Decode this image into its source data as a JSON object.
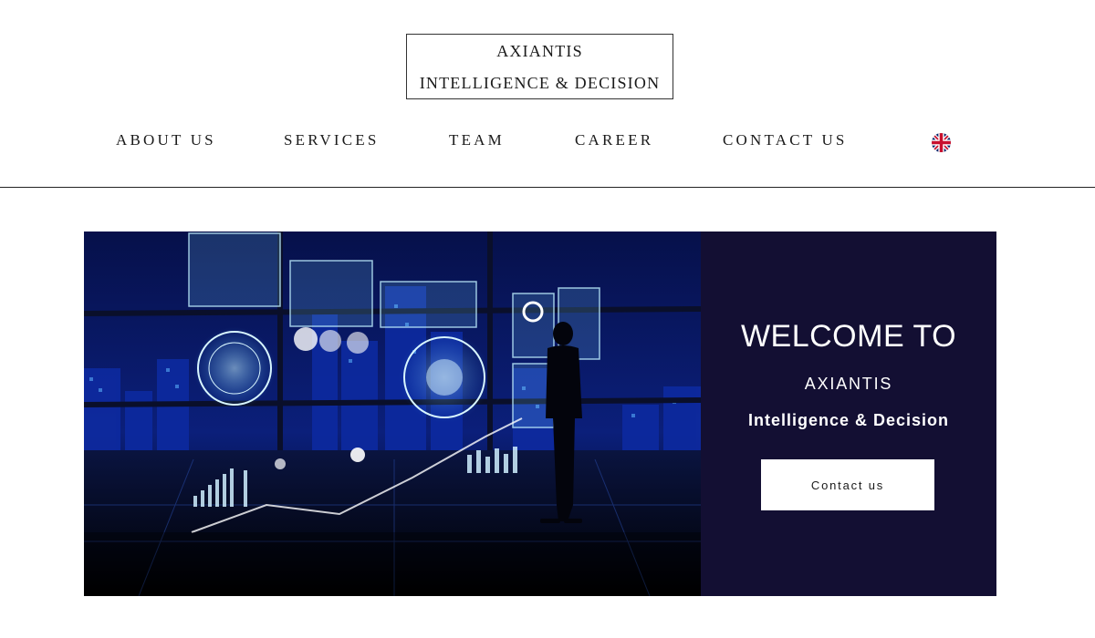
{
  "logo": {
    "line1": "AXIANTIS",
    "line2": "INTELLIGENCE & DECISION"
  },
  "nav": {
    "items": [
      {
        "label": "ABOUT US"
      },
      {
        "label": "SERVICES"
      },
      {
        "label": "TEAM"
      },
      {
        "label": "CAREER"
      },
      {
        "label": "CONTACT US"
      }
    ],
    "language_icon": "uk-flag-icon"
  },
  "hero": {
    "image_icon": "futuristic-city-dashboard-image",
    "welcome": "WELCOME TO",
    "brand": "AXIANTIS",
    "tagline": "Intelligence & Decision",
    "cta_label": "Contact us"
  },
  "colors": {
    "panel_bg": "#130f33",
    "text": "#1a1a1a",
    "accent_glow": "#7fd6ff"
  }
}
